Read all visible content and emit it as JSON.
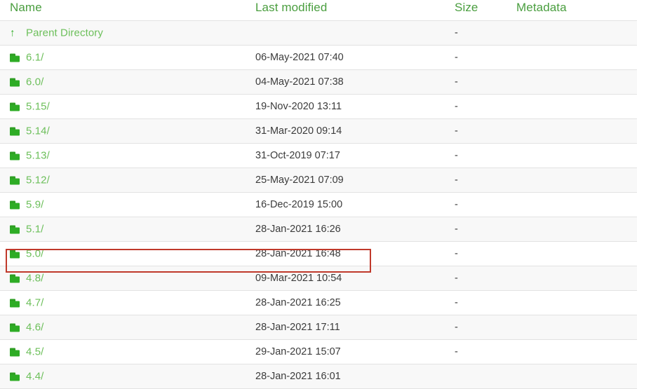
{
  "table": {
    "columns": [
      {
        "key": "name",
        "label": "Name"
      },
      {
        "key": "modified",
        "label": "Last modified"
      },
      {
        "key": "size",
        "label": "Size"
      },
      {
        "key": "metadata",
        "label": "Metadata"
      }
    ],
    "parent": {
      "icon": "up-arrow-icon",
      "glyph": "↑",
      "label": "Parent Directory",
      "modified": "",
      "size": "-",
      "metadata": ""
    },
    "rows": [
      {
        "icon": "folder-icon",
        "name": "6.1/",
        "modified": "06-May-2021 07:40",
        "size": "-",
        "metadata": ""
      },
      {
        "icon": "folder-icon",
        "name": "6.0/",
        "modified": "04-May-2021 07:38",
        "size": "-",
        "metadata": ""
      },
      {
        "icon": "folder-icon",
        "name": "5.15/",
        "modified": "19-Nov-2020 13:11",
        "size": "-",
        "metadata": ""
      },
      {
        "icon": "folder-icon",
        "name": "5.14/",
        "modified": "31-Mar-2020 09:14",
        "size": "-",
        "metadata": ""
      },
      {
        "icon": "folder-icon",
        "name": "5.13/",
        "modified": "31-Oct-2019 07:17",
        "size": "-",
        "metadata": ""
      },
      {
        "icon": "folder-icon",
        "name": "5.12/",
        "modified": "25-May-2021 07:09",
        "size": "-",
        "metadata": ""
      },
      {
        "icon": "folder-icon",
        "name": "5.9/",
        "modified": "16-Dec-2019 15:00",
        "size": "-",
        "metadata": ""
      },
      {
        "icon": "folder-icon",
        "name": "5.1/",
        "modified": "28-Jan-2021 16:26",
        "size": "-",
        "metadata": ""
      },
      {
        "icon": "folder-icon",
        "name": "5.0/",
        "modified": "28-Jan-2021 16:48",
        "size": "-",
        "metadata": "",
        "highlighted": true
      },
      {
        "icon": "folder-icon",
        "name": "4.8/",
        "modified": "09-Mar-2021 10:54",
        "size": "-",
        "metadata": ""
      },
      {
        "icon": "folder-icon",
        "name": "4.7/",
        "modified": "28-Jan-2021 16:25",
        "size": "-",
        "metadata": ""
      },
      {
        "icon": "folder-icon",
        "name": "4.6/",
        "modified": "28-Jan-2021 17:11",
        "size": "-",
        "metadata": ""
      },
      {
        "icon": "folder-icon",
        "name": "4.5/",
        "modified": "29-Jan-2021 15:07",
        "size": "-",
        "metadata": ""
      },
      {
        "icon": "folder-icon",
        "name": "4.4/",
        "modified": "28-Jan-2021 16:01",
        "size": "",
        "metadata": ""
      }
    ]
  },
  "colors": {
    "header_text": "#4a9e3f",
    "link_text": "#6cbf5a",
    "folder_icon": "#2eac25",
    "value_text": "#3b3b3b",
    "row_alt_background": "#f8f8f8",
    "row_border": "#e2e2e2",
    "highlight_border": "#c0392b"
  },
  "annotation": {
    "name": "highlight-box",
    "target_row": "5.0/"
  }
}
